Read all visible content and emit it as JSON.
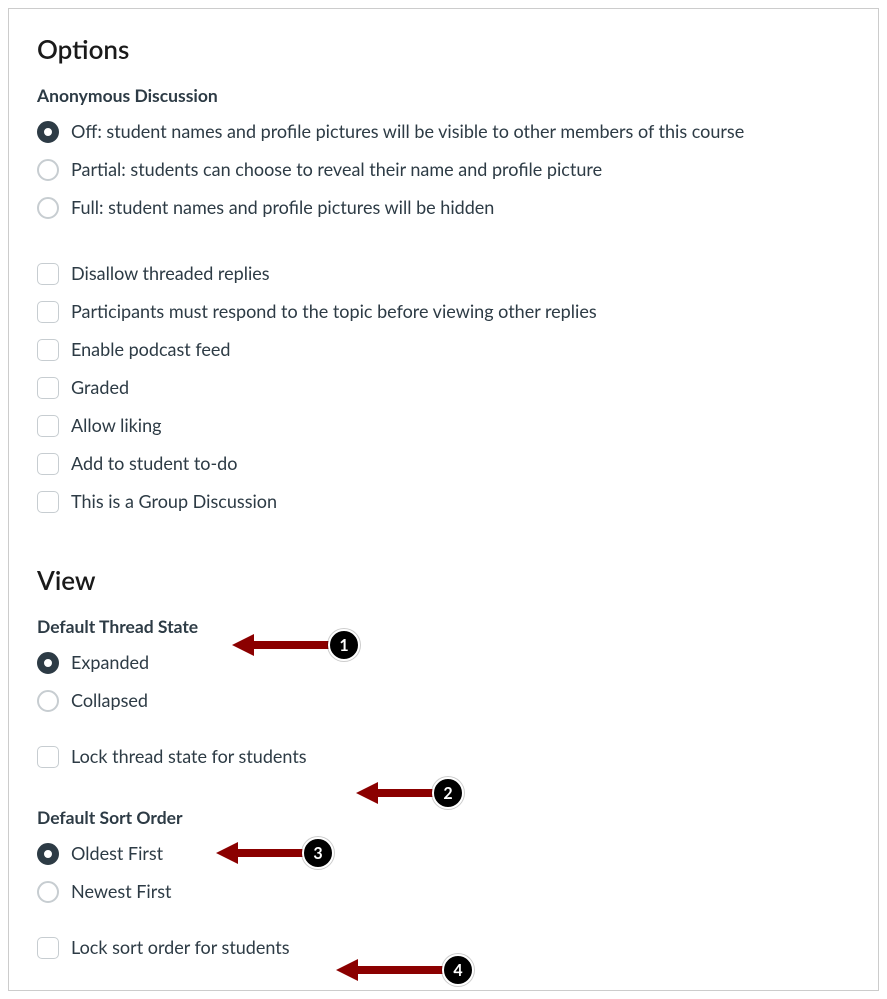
{
  "options": {
    "heading": "Options",
    "anon": {
      "title": "Anonymous Discussion",
      "off": "Off: student names and profile pictures will be visible to other members of this course",
      "partial": "Partial: students can choose to reveal their name and profile picture",
      "full": "Full: student names and profile pictures will be hidden",
      "selected": "off"
    },
    "checkboxes": {
      "disallow_threaded": "Disallow threaded replies",
      "must_respond": "Participants must respond to the topic before viewing other replies",
      "podcast": "Enable podcast feed",
      "graded": "Graded",
      "liking": "Allow liking",
      "todo": "Add to student to-do",
      "group": "This is a Group Discussion"
    }
  },
  "view": {
    "heading": "View",
    "thread_state": {
      "title": "Default Thread State",
      "expanded": "Expanded",
      "collapsed": "Collapsed",
      "selected": "expanded",
      "lock": "Lock thread state for students"
    },
    "sort_order": {
      "title": "Default Sort Order",
      "oldest": "Oldest First",
      "newest": "Newest First",
      "selected": "oldest",
      "lock": "Lock sort order for students"
    }
  },
  "callouts": {
    "c1": "1",
    "c2": "2",
    "c3": "3",
    "c4": "4"
  }
}
